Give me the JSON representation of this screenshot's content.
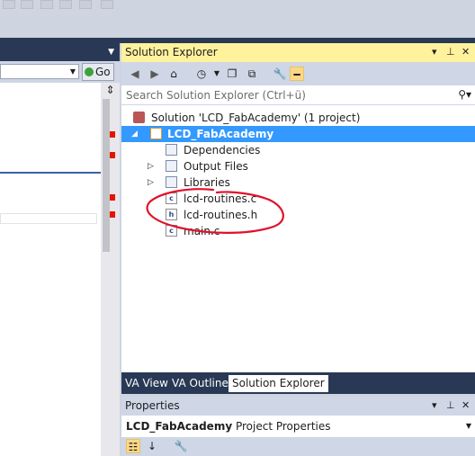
{
  "go_button": {
    "label": "Go"
  },
  "solution_explorer": {
    "title": "Solution Explorer",
    "search_placeholder": "Search Solution Explorer (Ctrl+ü)",
    "header_controls": {
      "menu": "▾",
      "pin": "📌",
      "close": "✕"
    }
  },
  "tree": {
    "solution": "Solution 'LCD_FabAcademy' (1 project)",
    "project": "LCD_FabAcademy",
    "items": [
      {
        "label": "Dependencies",
        "icon": "folder-icon"
      },
      {
        "label": "Output Files",
        "icon": "folder-icon"
      },
      {
        "label": "Libraries",
        "icon": "folder-icon"
      },
      {
        "label": "lcd-routines.c",
        "icon": "c-file-icon"
      },
      {
        "label": "lcd-routines.h",
        "icon": "h-file-icon"
      },
      {
        "label": "main.c",
        "icon": "c-file-icon"
      }
    ]
  },
  "tabs": [
    "VA View",
    "VA Outline",
    "Solution Explorer"
  ],
  "properties": {
    "title": "Properties",
    "object_name": "LCD_FabAcademy",
    "object_type": "Project Properties"
  },
  "colors": {
    "accent": "#3399ff",
    "header_active": "#fff29d",
    "dark": "#293955",
    "annotation": "#e0102a"
  }
}
